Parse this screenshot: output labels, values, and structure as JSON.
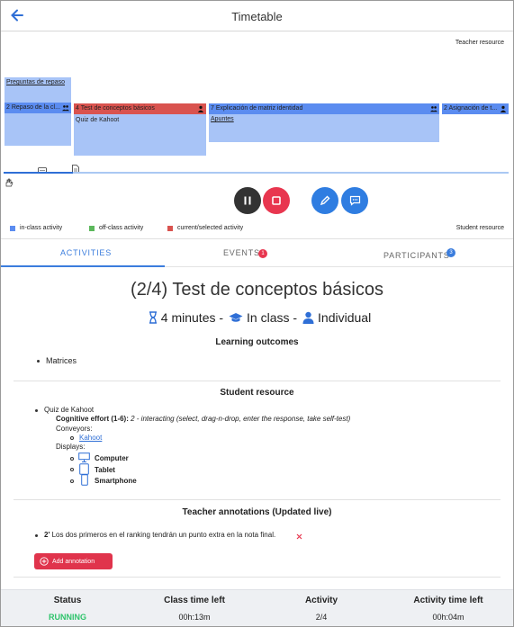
{
  "header": {
    "title": "Timetable"
  },
  "timeline": {
    "teacher_resource_label": "Teacher resource",
    "student_resource_label": "Student resource",
    "blocks": {
      "preguntas": "Preguntas de repaso",
      "repaso": "2 Repaso de la cl...",
      "test": "4 Test de conceptos básicos",
      "test_sub": "Quiz de Kahoot",
      "explicacion": "7 Explicación de matriz identidad",
      "explicacion_sub": "Apuntes",
      "asignacion": "2 Asignación de t..."
    },
    "legend": {
      "in_class": "in-class activity",
      "off_class": "off-class activity",
      "current": "current/selected activity"
    },
    "colors": {
      "in_class": "#5b8cf0",
      "off_class": "#5cb85c",
      "current": "#d9534f",
      "accent": "#2f6fd6",
      "stop": "#e8364f"
    }
  },
  "tabs": {
    "activities": "ACTIVITIES",
    "events": "EVENTS",
    "events_badge": "1",
    "participants": "PARTICIPANTS",
    "participants_badge": "3"
  },
  "activity": {
    "title": "(2/4) Test de conceptos básicos",
    "duration": "4 minutes -",
    "mode": "In class -",
    "grouping": "Individual"
  },
  "learning": {
    "heading": "Learning outcomes",
    "items": [
      "Matrices"
    ]
  },
  "student_resource": {
    "heading": "Student resource",
    "name": "Quiz de Kahoot",
    "effort_label": "Cognitive effort (1-6):",
    "effort_value": "2 - interacting (select, drag-n-drop, enter the response, take self-test)",
    "conveyors_label": "Conveyors:",
    "conveyor_link": "Kahoot",
    "displays_label": "Displays:",
    "displays": [
      "Computer",
      "Tablet",
      "Smartphone"
    ]
  },
  "annotations": {
    "heading": "Teacher annotations (Updated live)",
    "items": [
      {
        "time": "2'",
        "text": "Los dos primeros en el ranking tendrán un punto extra en la nota final."
      }
    ],
    "add_label": "Add annotation"
  },
  "status": {
    "status_label": "Status",
    "status_value": "RUNNING",
    "class_time_label": "Class time left",
    "class_time_value": "00h:13m",
    "activity_label": "Activity",
    "activity_value": "2/4",
    "activity_time_label": "Activity time left",
    "activity_time_value": "00h:04m"
  }
}
